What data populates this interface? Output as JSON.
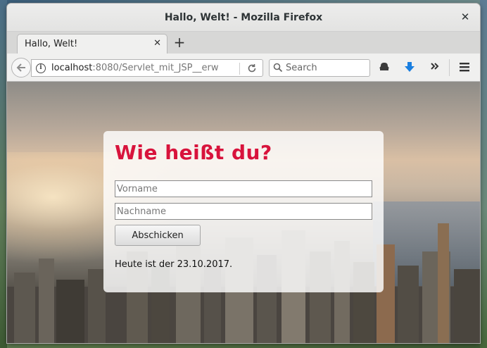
{
  "window": {
    "title": "Hallo, Welt! - Mozilla Firefox",
    "close_glyph": "✕"
  },
  "tab": {
    "label": "Hallo, Welt!",
    "close_glyph": "✕",
    "new_tab_glyph": "+"
  },
  "navbar": {
    "url_host": "localhost",
    "url_rest": ":8080/Servlet_mit_JSP__erw",
    "search_placeholder": "Search",
    "icons": [
      "back-arrow-icon",
      "info-icon",
      "reload-icon",
      "search-icon",
      "account-icon",
      "download-icon",
      "overflow-chevrons-icon",
      "hamburger-menu-icon"
    ],
    "download_color": "#1a7fe0"
  },
  "page": {
    "heading": "Wie heißt du?",
    "heading_color": "#d8133c",
    "first_name_placeholder": "Vorname",
    "last_name_placeholder": "Nachname",
    "submit_label": "Abschicken",
    "date_text": "Heute ist der 23.10.2017."
  }
}
